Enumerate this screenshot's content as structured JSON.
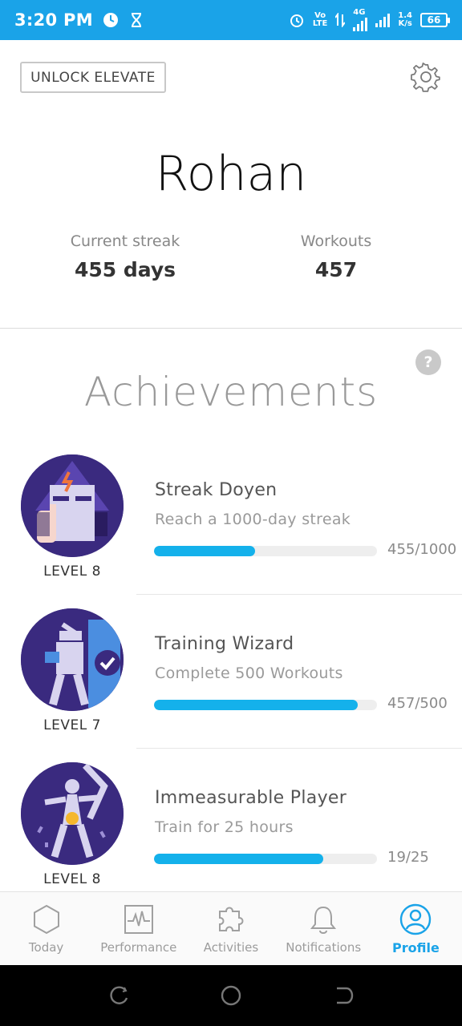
{
  "status_bar": {
    "time": "3:20 PM",
    "network_top": "Vo",
    "network_bottom": "LTE",
    "net_type": "4G",
    "speed_top": "1.4",
    "speed_bottom": "K/s",
    "battery": "66"
  },
  "header": {
    "unlock_label": "UNLOCK ELEVATE",
    "username": "Rohan",
    "streak_label": "Current streak",
    "streak_value": "455 days",
    "workouts_label": "Workouts",
    "workouts_value": "457"
  },
  "achievements": {
    "title": "Achievements",
    "help_label": "?",
    "items": [
      {
        "name": "Streak Doyen",
        "description": "Reach a 1000-day streak",
        "level": "LEVEL 8",
        "progress_text": "455/1000",
        "progress": 0.455
      },
      {
        "name": "Training Wizard",
        "description": "Complete 500 Workouts",
        "level": "LEVEL 7",
        "progress_text": "457/500",
        "progress": 0.914
      },
      {
        "name": "Immeasurable Player",
        "description": "Train for 25 hours",
        "level": "LEVEL 8",
        "progress_text": "19/25",
        "progress": 0.76
      }
    ]
  },
  "bottom_nav": {
    "items": [
      {
        "label": "Today",
        "icon": "hexagon-icon"
      },
      {
        "label": "Performance",
        "icon": "heartbeat-chart-icon"
      },
      {
        "label": "Activities",
        "icon": "puzzle-icon"
      },
      {
        "label": "Notifications",
        "icon": "bell-icon"
      },
      {
        "label": "Profile",
        "icon": "profile-icon"
      }
    ],
    "active": "Profile"
  },
  "colors": {
    "accent": "#1aa3e8",
    "progress": "#14b1eb",
    "badge_bg": "#3a2a7f"
  }
}
